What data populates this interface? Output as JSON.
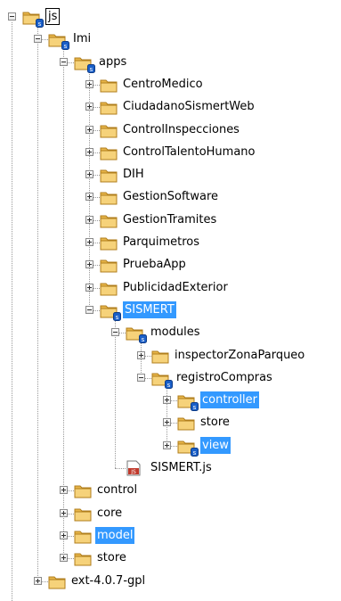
{
  "tree": {
    "nodes": [
      {
        "label": "js",
        "depth": 0,
        "expanded": true,
        "service": true,
        "boxed": true,
        "selected": false
      },
      {
        "label": "Imi",
        "depth": 1,
        "expanded": true,
        "service": true,
        "selected": false
      },
      {
        "label": "apps",
        "depth": 2,
        "expanded": true,
        "service": true,
        "selected": false
      },
      {
        "label": "CentroMedico",
        "depth": 3,
        "expanded": false,
        "service": false,
        "selected": false
      },
      {
        "label": "CiudadanoSismertWeb",
        "depth": 3,
        "expanded": false,
        "service": false,
        "selected": false
      },
      {
        "label": "ControlInspecciones",
        "depth": 3,
        "expanded": false,
        "service": false,
        "selected": false
      },
      {
        "label": "ControlTalentoHumano",
        "depth": 3,
        "expanded": false,
        "service": false,
        "selected": false
      },
      {
        "label": "DIH",
        "depth": 3,
        "expanded": false,
        "service": false,
        "selected": false
      },
      {
        "label": "GestionSoftware",
        "depth": 3,
        "expanded": false,
        "service": false,
        "selected": false
      },
      {
        "label": "GestionTramites",
        "depth": 3,
        "expanded": false,
        "service": false,
        "selected": false
      },
      {
        "label": "Parquimetros",
        "depth": 3,
        "expanded": false,
        "service": false,
        "selected": false
      },
      {
        "label": "PruebaApp",
        "depth": 3,
        "expanded": false,
        "service": false,
        "selected": false
      },
      {
        "label": "PublicidadExterior",
        "depth": 3,
        "expanded": false,
        "service": false,
        "selected": false
      },
      {
        "label": "SISMERT",
        "depth": 3,
        "expanded": true,
        "service": true,
        "selected": true
      },
      {
        "label": "modules",
        "depth": 4,
        "expanded": true,
        "service": true,
        "selected": false
      },
      {
        "label": "inspectorZonaParqueo",
        "depth": 5,
        "expanded": false,
        "service": false,
        "selected": false
      },
      {
        "label": "registroCompras",
        "depth": 5,
        "expanded": true,
        "service": true,
        "selected": false
      },
      {
        "label": "controller",
        "depth": 6,
        "expanded": false,
        "service": true,
        "selected": true
      },
      {
        "label": "store",
        "depth": 6,
        "expanded": false,
        "service": false,
        "selected": false
      },
      {
        "label": "view",
        "depth": 6,
        "expanded": false,
        "service": true,
        "selected": true
      },
      {
        "label": "SISMERT.js",
        "depth": 4,
        "file": true,
        "service": false,
        "selected": false
      },
      {
        "label": "control",
        "depth": 2,
        "expanded": false,
        "service": false,
        "selected": false
      },
      {
        "label": "core",
        "depth": 2,
        "expanded": false,
        "service": false,
        "selected": false
      },
      {
        "label": "model",
        "depth": 2,
        "expanded": false,
        "service": false,
        "selected": true
      },
      {
        "label": "store",
        "depth": 2,
        "expanded": false,
        "service": false,
        "selected": false
      },
      {
        "label": "ext-4.0.7-gpl",
        "depth": 1,
        "expanded": false,
        "service": false,
        "selected": false
      }
    ],
    "file_badge": "JS"
  },
  "colors": {
    "selection": "#3399ff",
    "folder": "#e8b64a",
    "service_badge": "#1a5fc8"
  },
  "icons": {
    "folder": "folder-icon",
    "service": "service-badge-icon",
    "js_file": "js-file-icon",
    "expand": "plus-icon",
    "collapse": "minus-icon"
  }
}
